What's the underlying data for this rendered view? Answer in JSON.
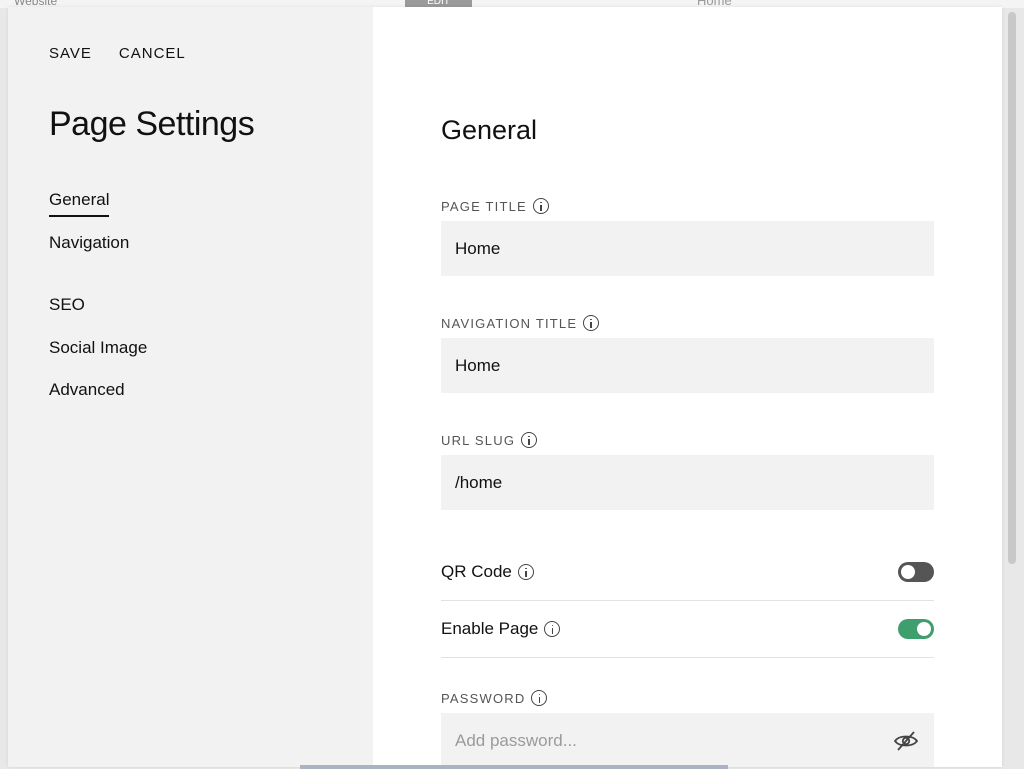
{
  "backdrop": {
    "left_text": "Website",
    "edit_label": "EDIT",
    "page_label": "Home"
  },
  "toolbar": {
    "save_label": "SAVE",
    "cancel_label": "CANCEL"
  },
  "sidebar": {
    "title": "Page Settings",
    "items": [
      {
        "label": "General",
        "active": true
      },
      {
        "label": "Navigation",
        "active": false
      },
      {
        "label": "SEO",
        "active": false
      },
      {
        "label": "Social Image",
        "active": false
      },
      {
        "label": "Advanced",
        "active": false
      }
    ]
  },
  "main": {
    "title": "General",
    "page_title": {
      "label": "PAGE TITLE",
      "value": "Home"
    },
    "navigation_title": {
      "label": "NAVIGATION TITLE",
      "value": "Home"
    },
    "url_slug": {
      "label": "URL SLUG",
      "value": "/home"
    },
    "qr_code": {
      "label": "QR Code",
      "enabled": false
    },
    "enable_page": {
      "label": "Enable Page",
      "enabled": true
    },
    "password": {
      "label": "PASSWORD",
      "placeholder": "Add password..."
    }
  },
  "colors": {
    "toggle_on": "#3f9e6e",
    "toggle_off": "#555555",
    "sidebar_bg": "#f2f2f2"
  },
  "icons": {
    "info": "info-icon",
    "password_visibility": "eye-off-icon"
  }
}
